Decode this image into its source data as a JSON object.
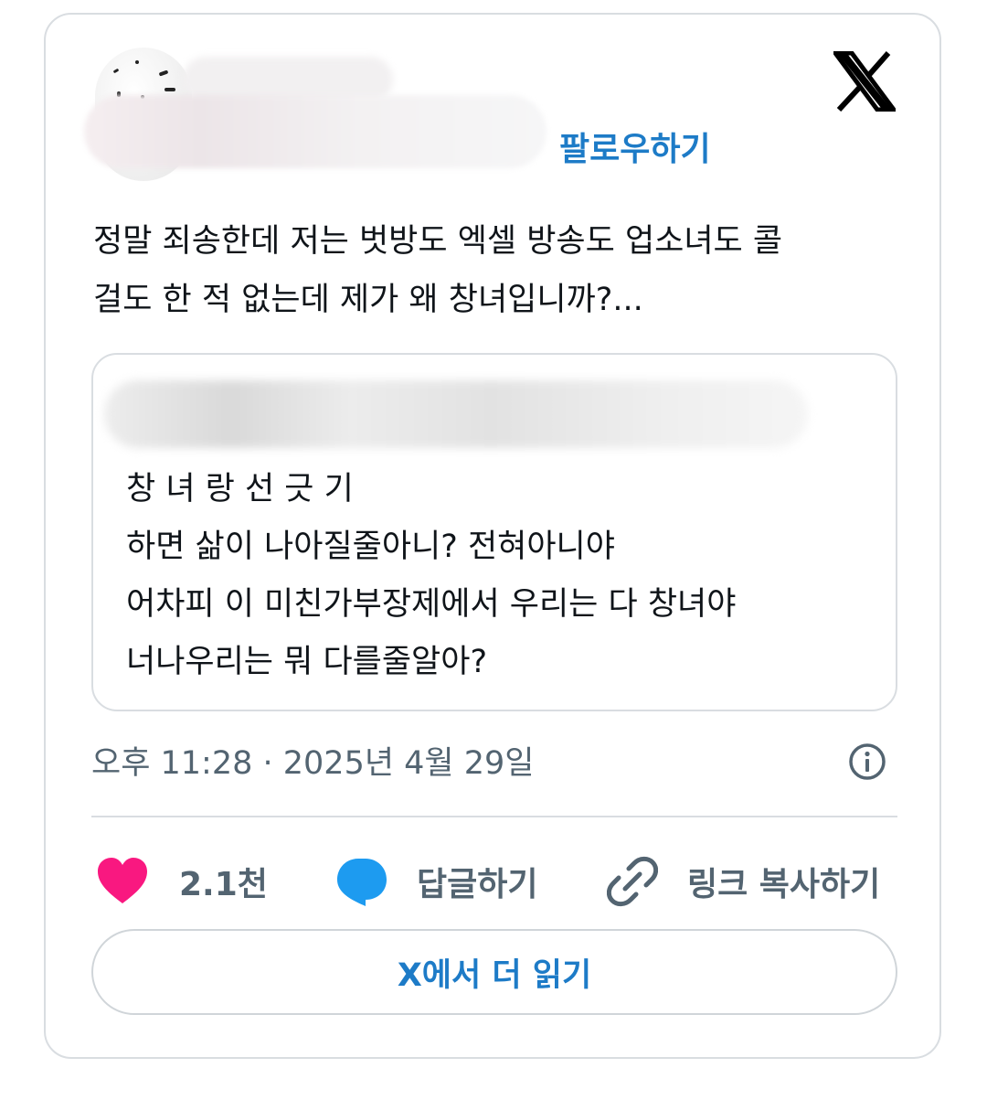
{
  "header": {
    "follow_label": "팔로우하기",
    "logo_icon": "x-logo-icon",
    "avatar_icon": "avatar"
  },
  "tweet": {
    "text": "정말 죄송한데 저는 벗방도 엑셀 방송도 업소녀도 콜\n걸도 한 적 없는데 제가 왜 창녀입니까?..."
  },
  "quoted": {
    "text": "창 녀 랑 선 긋 기\n하면 삶이 나아질줄아니? 전혀아니야\n어차피 이 미친가부장제에서 우리는 다 창녀야\n너나우리는 뭐 다를줄알아?"
  },
  "timestamp": "오후 11:28 · 2025년 4월 29일",
  "actions": {
    "like_count": "2.1천",
    "reply_label": "답글하기",
    "copy_link_label": "링크 복사하기"
  },
  "read_more_label": "X에서 더 읽기",
  "colors": {
    "accent": "#1d7bc7",
    "like": "#f91880",
    "reply": "#1d9bf0",
    "muted": "#536471",
    "border": "#d9dde1"
  }
}
